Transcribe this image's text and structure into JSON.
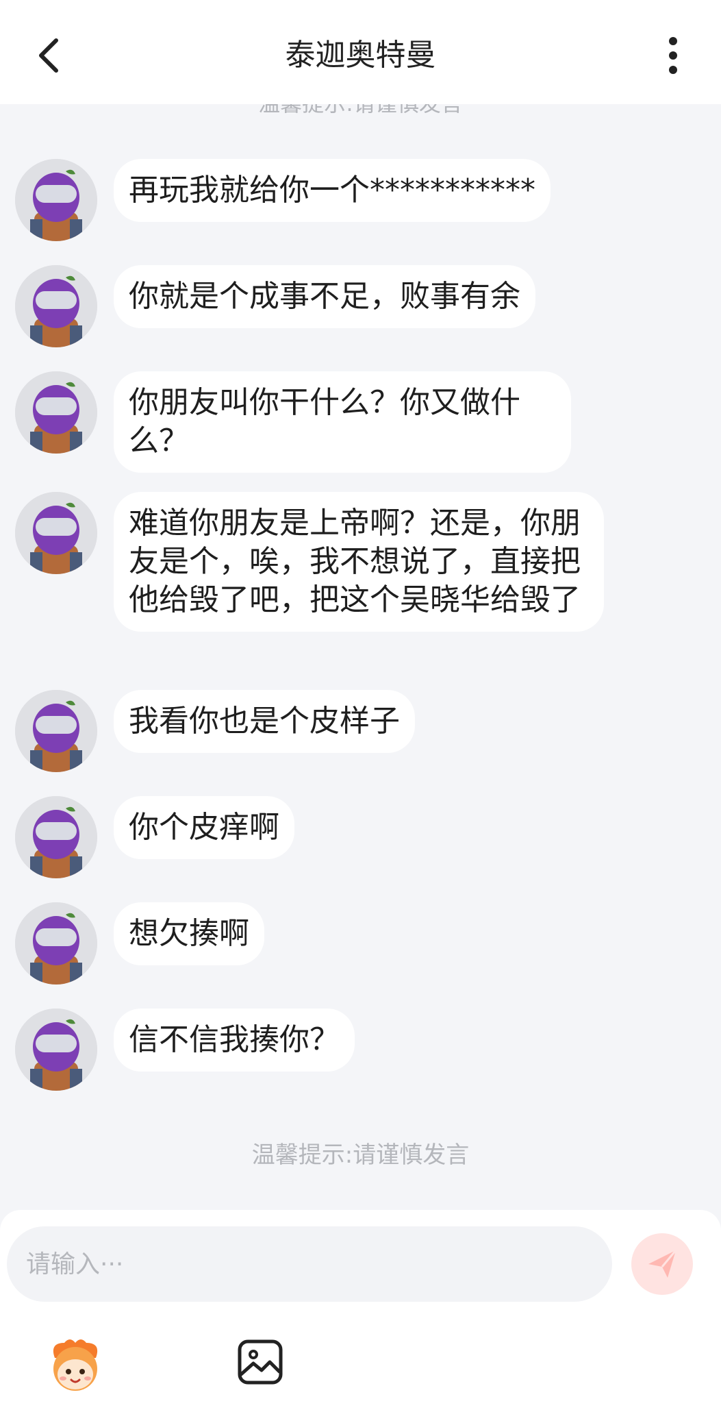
{
  "header": {
    "title": "泰迦奥特曼"
  },
  "tips": {
    "top": "温馨提示:请谨慎发言",
    "bottom": "温馨提示:请谨慎发言"
  },
  "messages": [
    {
      "text": "再玩我就给你一个***********"
    },
    {
      "text": "你就是个成事不足，败事有余"
    },
    {
      "text": "你朋友叫你干什么？你又做什么？"
    },
    {
      "text": "难道你朋友是上帝啊？还是，你朋友是个，唉，我不想说了，直接把他给毁了吧，把这个吴晓华给毁了"
    },
    {
      "text": "我看你也是个皮样子"
    },
    {
      "text": "你个皮痒啊"
    },
    {
      "text": "想欠揍啊"
    },
    {
      "text": "信不信我揍你？"
    }
  ],
  "input": {
    "placeholder": "请输入···"
  },
  "icons": {
    "back": "chevron-left-icon",
    "more": "more-vertical-icon",
    "send": "paper-plane-icon",
    "emoji": "emoji-sticker-icon",
    "image": "image-icon"
  },
  "colors": {
    "background": "#f4f5f8",
    "bubble": "#ffffff",
    "tip": "#b4b6bb",
    "send_button": "#ffe3e1",
    "send_icon": "#ffb8b2",
    "avatar_purple": "#7d3fb4"
  }
}
